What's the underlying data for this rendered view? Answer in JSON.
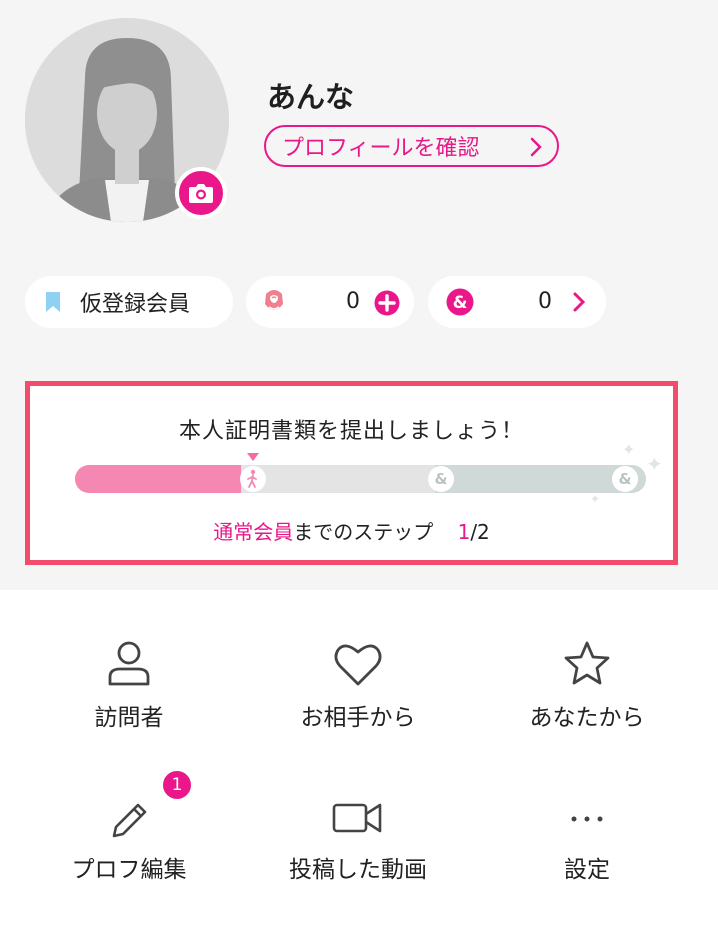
{
  "profile": {
    "name": "あんな",
    "profile_button_label": "プロフィールを確認",
    "camera_icon": "camera-icon",
    "avatar_icon": "female-silhouette-avatar"
  },
  "stats": {
    "membership_label": "仮登録会員",
    "membership_icon": "bookmark-icon",
    "rose_count": "0",
    "rose_icon": "rose-icon",
    "rose_action_icon": "plus-circle-icon",
    "match_count": "0",
    "match_icon": "ampersand-icon",
    "match_action_icon": "chevron-right-icon"
  },
  "verification": {
    "title": "本人証明書類を提出しましょう！",
    "goal_prefix": "通常会員",
    "goal_suffix": "までのステップ",
    "current_step": "1",
    "total_steps": "/2",
    "progress_fraction": 0.29
  },
  "menu": [
    {
      "label": "訪問者",
      "icon": "person-icon"
    },
    {
      "label": "お相手から",
      "icon": "heart-icon"
    },
    {
      "label": "あなたから",
      "icon": "star-icon"
    },
    {
      "label": "プロフ編集",
      "icon": "pencil-icon",
      "badge": "1"
    },
    {
      "label": "投稿した動画",
      "icon": "video-camera-icon"
    },
    {
      "label": "設定",
      "icon": "more-dots-icon"
    }
  ],
  "colors": {
    "accent": "#e9178a",
    "card_border": "#f24b6b",
    "progress_fill": "#f587b3",
    "membership_bookmark": "#8fd0f5"
  }
}
